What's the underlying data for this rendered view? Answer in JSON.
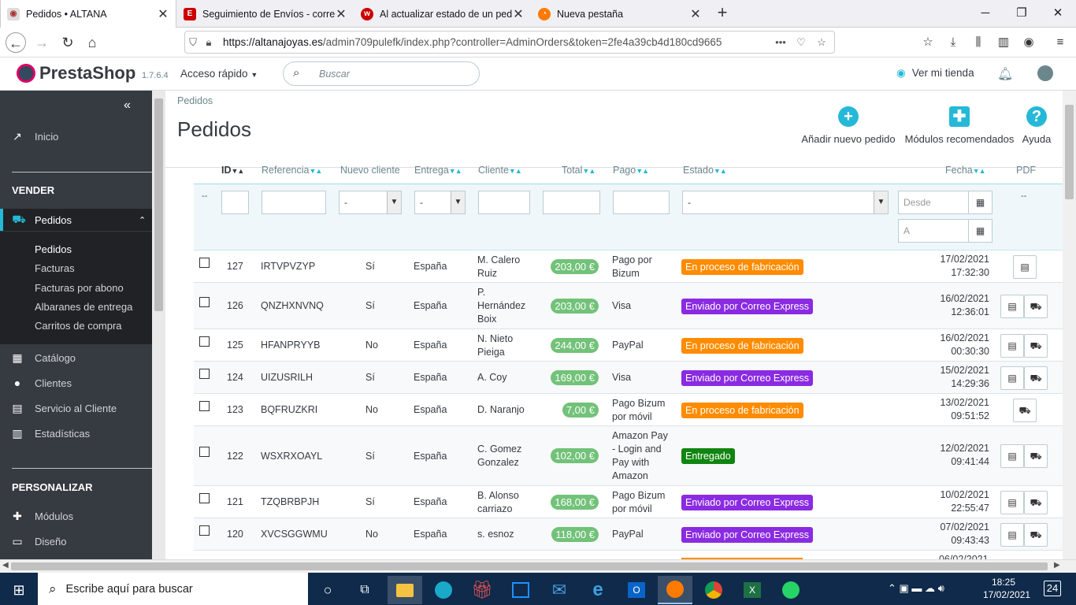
{
  "browser": {
    "tabs": [
      {
        "title": "Pedidos • ALTANA",
        "active": true,
        "icon": "prestashop-icon"
      },
      {
        "title": "Seguimiento de Envíos - correo",
        "active": false,
        "icon": "express-icon"
      },
      {
        "title": "Al actualizar estado de un pedido",
        "active": false,
        "icon": "w-icon"
      },
      {
        "title": "Nueva pestaña",
        "active": false,
        "icon": "firefox-icon"
      }
    ],
    "url_domain": "https://altanajoyas.es",
    "url_path": "/admin709pulefk/index.php?controller=AdminOrders&token=2fe4a39cb4d180cd9665"
  },
  "header": {
    "brand": "PrestaShop",
    "version": "1.7.6.4",
    "quick_access": "Acceso rápido",
    "search_placeholder": "Buscar",
    "view_store": "Ver mi tienda"
  },
  "sidebar": {
    "inicio": "Inicio",
    "section_sell": "VENDER",
    "pedidos": "Pedidos",
    "subitems": [
      "Pedidos",
      "Facturas",
      "Facturas por abono",
      "Albaranes de entrega",
      "Carritos de compra"
    ],
    "catalogo": "Catálogo",
    "clientes": "Clientes",
    "servicio": "Servicio al Cliente",
    "estadisticas": "Estadísticas",
    "section_customize": "PERSONALIZAR",
    "modulos": "Módulos",
    "diseno": "Diseño"
  },
  "page": {
    "breadcrumb": "Pedidos",
    "title": "Pedidos",
    "actions": {
      "add": "Añadir nuevo pedido",
      "modules": "Módulos recomendados",
      "help": "Ayuda"
    }
  },
  "table": {
    "headers": {
      "id": "ID",
      "ref": "Referencia",
      "new": "Nuevo cliente",
      "delivery": "Entrega",
      "customer": "Cliente",
      "total": "Total",
      "payment": "Pago",
      "status": "Estado",
      "date": "Fecha",
      "pdf": "PDF"
    },
    "filters": {
      "id_dash": "--",
      "new_select": "-",
      "delivery_select": "-",
      "status_select": "-",
      "from": "Desde",
      "to": "A",
      "pdf_dash": "--"
    },
    "rows": [
      {
        "id": "127",
        "ref": "IRTVPVZYP",
        "new": "Sí",
        "country": "España",
        "customer": "M. Calero Ruiz",
        "total": "203,00 €",
        "payment": "Pago por Bizum",
        "status": "En proceso de fabricación",
        "status_color": "#ff8c00",
        "date": "17/02/2021",
        "time": "17:32:30",
        "invoice": true,
        "delivery": false
      },
      {
        "id": "126",
        "ref": "QNZHXNVNQ",
        "new": "Sí",
        "country": "España",
        "customer": "P. Hernández Boix",
        "total": "203,00 €",
        "payment": "Visa",
        "status": "Enviado por Correo Express",
        "status_color": "#8a2be2",
        "date": "16/02/2021",
        "time": "12:36:01",
        "invoice": true,
        "delivery": true
      },
      {
        "id": "125",
        "ref": "HFANPRYYB",
        "new": "No",
        "country": "España",
        "customer": "N. Nieto Pieiga",
        "total": "244,00 €",
        "payment": "PayPal",
        "status": "En proceso de fabricación",
        "status_color": "#ff8c00",
        "date": "16/02/2021",
        "time": "00:30:30",
        "invoice": true,
        "delivery": true
      },
      {
        "id": "124",
        "ref": "UIZUSRILH",
        "new": "Sí",
        "country": "España",
        "customer": "A. Coy",
        "total": "169,00 €",
        "payment": "Visa",
        "status": "Enviado por Correo Express",
        "status_color": "#8a2be2",
        "date": "15/02/2021",
        "time": "14:29:36",
        "invoice": true,
        "delivery": true
      },
      {
        "id": "123",
        "ref": "BQFRUZKRI",
        "new": "No",
        "country": "España",
        "customer": "D. Naranjo",
        "total": "7,00 €",
        "payment": "Pago Bizum por móvil",
        "status": "En proceso de fabricación",
        "status_color": "#ff8c00",
        "date": "13/02/2021",
        "time": "09:51:52",
        "invoice": false,
        "delivery": true
      },
      {
        "id": "122",
        "ref": "WSXRXOAYL",
        "new": "Sí",
        "country": "España",
        "customer": "C. Gomez Gonzalez",
        "total": "102,00 €",
        "payment": "Amazon Pay - Login and Pay with Amazon",
        "status": "Entregado",
        "status_color": "#108510",
        "date": "12/02/2021",
        "time": "09:41:44",
        "invoice": true,
        "delivery": true
      },
      {
        "id": "121",
        "ref": "TZQBRBPJH",
        "new": "Sí",
        "country": "España",
        "customer": "B. Alonso carriazo",
        "total": "168,00 €",
        "payment": "Pago Bizum por móvil",
        "status": "Enviado por Correo Express",
        "status_color": "#8a2be2",
        "date": "10/02/2021",
        "time": "22:55:47",
        "invoice": true,
        "delivery": true
      },
      {
        "id": "120",
        "ref": "XVCSGGWMU",
        "new": "No",
        "country": "España",
        "customer": "s. esnoz",
        "total": "118,00 €",
        "payment": "PayPal",
        "status": "Enviado por Correo Express",
        "status_color": "#8a2be2",
        "date": "07/02/2021",
        "time": "09:43:43",
        "invoice": true,
        "delivery": true
      }
    ],
    "partial_date": "06/02/2021"
  },
  "taskbar": {
    "search_placeholder": "Escribe aquí para buscar",
    "time": "18:25",
    "date": "17/02/2021",
    "notifications": "24"
  }
}
